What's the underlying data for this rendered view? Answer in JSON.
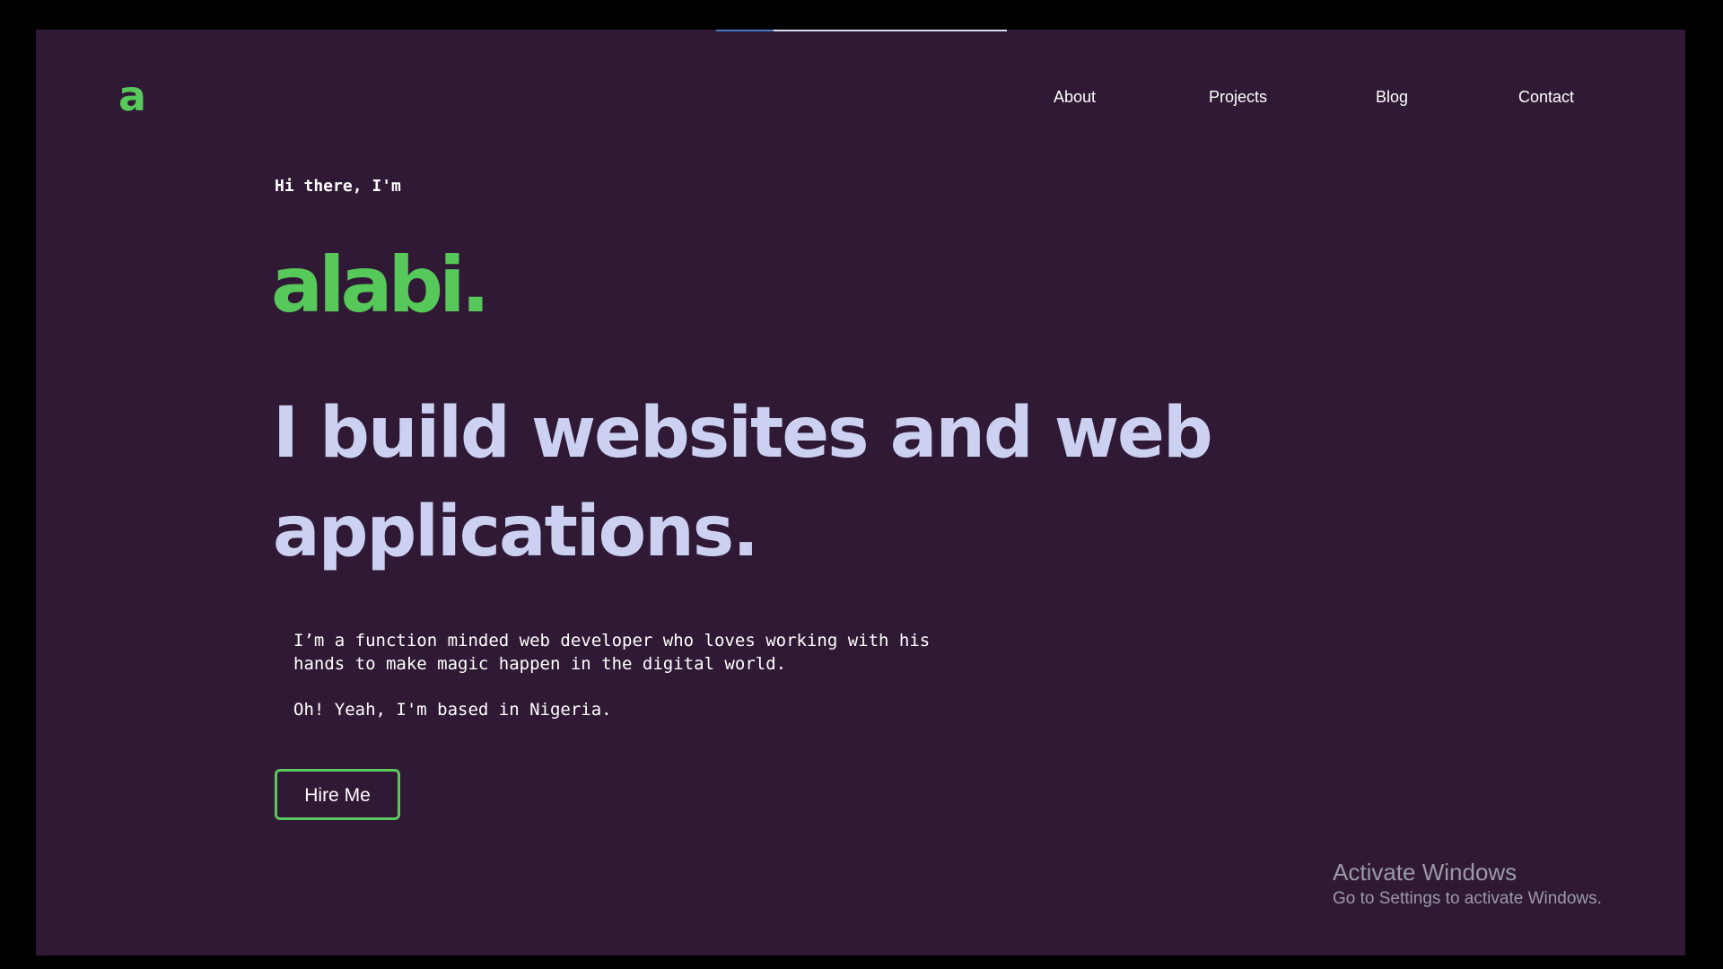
{
  "brand": {
    "logo_letter": "a",
    "accent_color": "#57c95a",
    "background_color": "#301934",
    "headline_color": "#ccd1f2"
  },
  "nav": {
    "items": [
      {
        "label": "About"
      },
      {
        "label": "Projects"
      },
      {
        "label": "Blog"
      },
      {
        "label": "Contact"
      }
    ]
  },
  "hero": {
    "greeting": "Hi there, I'm",
    "name": "alabi.",
    "headline": "I build websites and web applications.",
    "bio": [
      "I’m a function minded web developer who loves working with his hands to make magic happen in the digital world.",
      "Oh! Yeah, I'm based in Nigeria."
    ],
    "cta_label": "Hire Me"
  },
  "os_watermark": {
    "title": "Activate Windows",
    "subtitle": "Go to Settings to activate Windows."
  }
}
